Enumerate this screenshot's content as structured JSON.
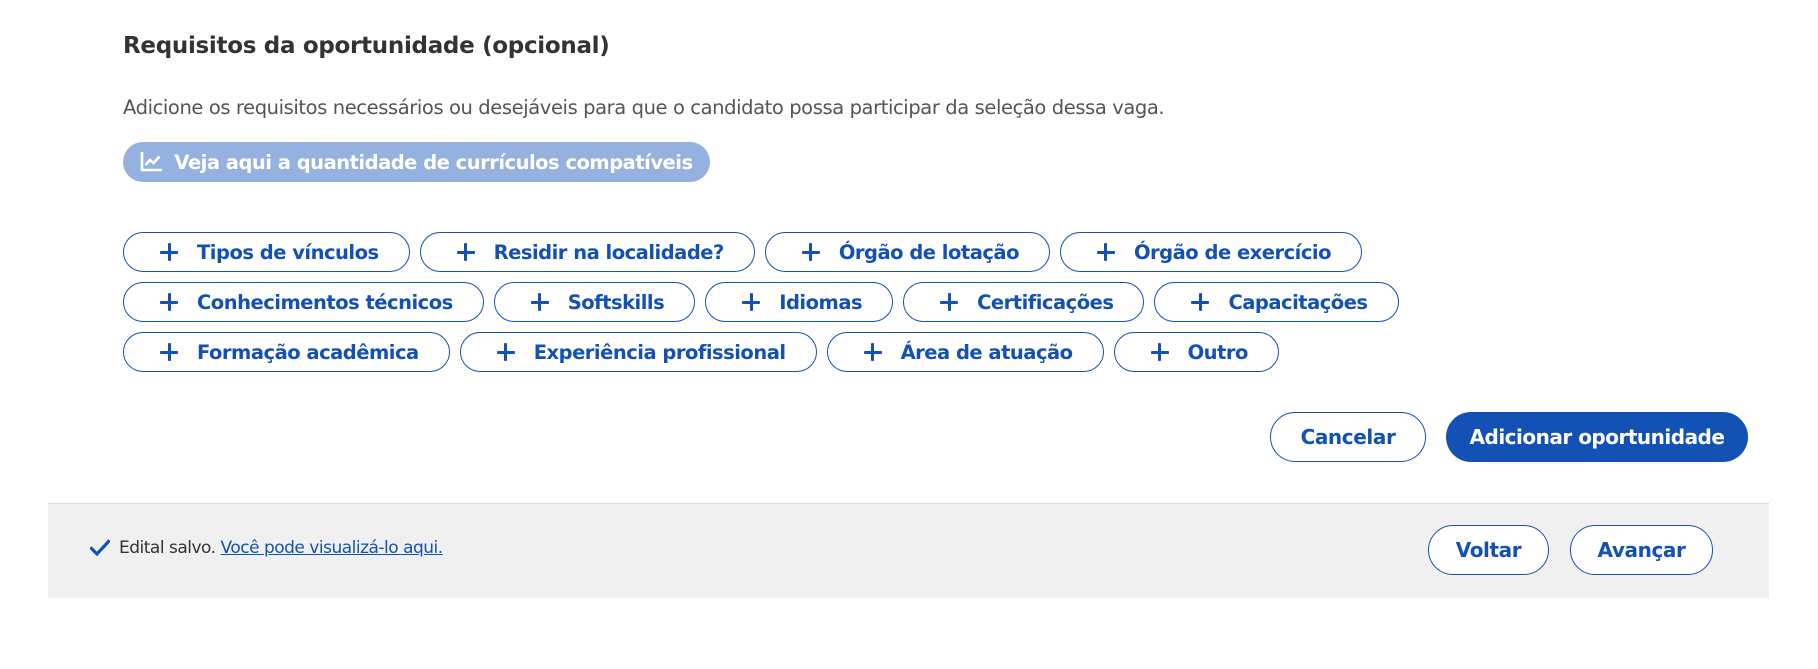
{
  "section": {
    "title": "Requisitos da oportunidade (opcional)",
    "description": "Adicione os requisitos necessários ou desejáveis para que o candidato possa participar da seleção dessa vaga."
  },
  "compat_button": {
    "icon": "chart-line-icon",
    "label": "Veja aqui a quantidade de currículos compatíveis"
  },
  "requirement_chips": [
    {
      "icon": "plus-icon",
      "label": "Tipos de vínculos"
    },
    {
      "icon": "plus-icon",
      "label": "Residir na localidade?"
    },
    {
      "icon": "plus-icon",
      "label": "Órgão de lotação"
    },
    {
      "icon": "plus-icon",
      "label": "Órgão de exercício"
    },
    {
      "icon": "plus-icon",
      "label": "Conhecimentos técnicos"
    },
    {
      "icon": "plus-icon",
      "label": "Softskills"
    },
    {
      "icon": "plus-icon",
      "label": "Idiomas"
    },
    {
      "icon": "plus-icon",
      "label": "Certificações"
    },
    {
      "icon": "plus-icon",
      "label": "Capacitações"
    },
    {
      "icon": "plus-icon",
      "label": "Formação acadêmica"
    },
    {
      "icon": "plus-icon",
      "label": "Experiência profissional"
    },
    {
      "icon": "plus-icon",
      "label": "Área de atuação"
    },
    {
      "icon": "plus-icon",
      "label": "Outro"
    }
  ],
  "actions": {
    "cancel_label": "Cancelar",
    "add_label": "Adicionar oportunidade"
  },
  "footer": {
    "status_icon": "check-icon",
    "saved_text": "Edital salvo.",
    "saved_link": "Você pode visualizá-lo aqui.",
    "back_label": "Voltar",
    "next_label": "Avançar"
  },
  "colors": {
    "primary": "#1351b4",
    "primary_light": "#94b1e0",
    "footer_bg": "#f0f0f0",
    "text": "#333333"
  }
}
